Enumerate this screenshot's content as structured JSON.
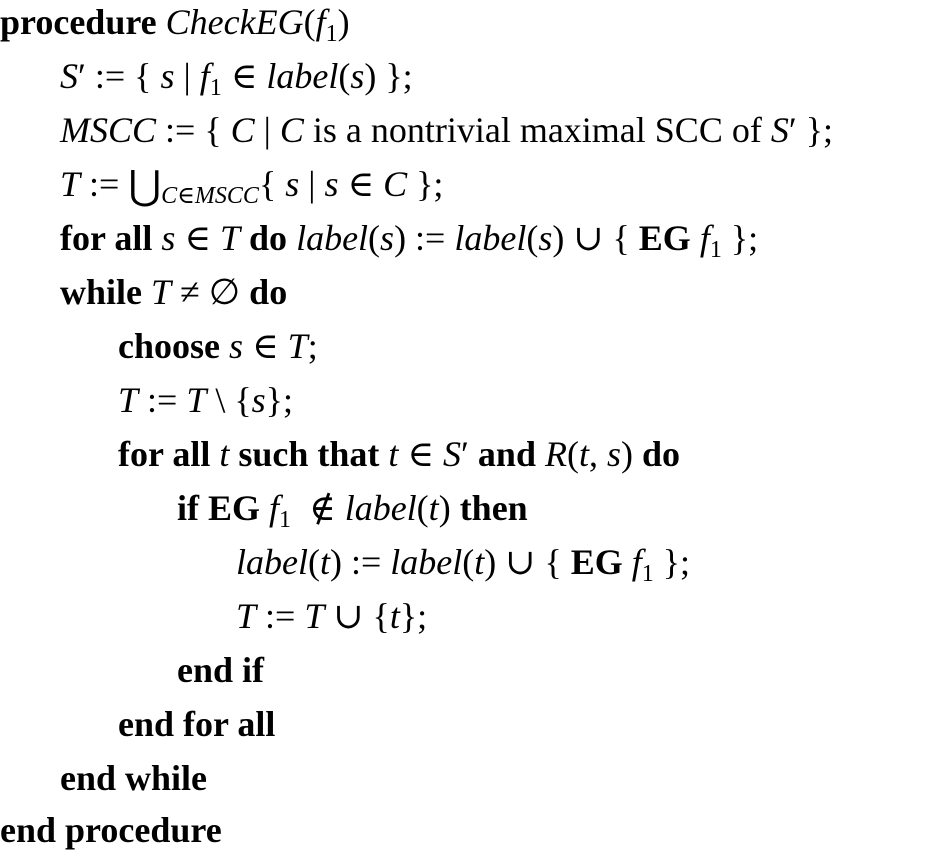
{
  "keywords": {
    "procedure": "procedure",
    "for_all": "for all",
    "do": "do",
    "while": "while",
    "choose": "choose",
    "such_that": "such that",
    "and": "and",
    "if": "if",
    "then": "then",
    "end_if": "end if",
    "end_for_all": "end for all",
    "end_while": "end while",
    "end_procedure": "end procedure",
    "EG": "EG"
  },
  "names": {
    "proc_name": "CheckEG",
    "f": "f",
    "one": "1",
    "S": "S",
    "label": "label",
    "MSCC": "MSCC",
    "T": "T",
    "C": "C",
    "s": "s",
    "t": "t",
    "R": "R",
    "cmscc": "C∈MSCC"
  },
  "text": {
    "nontrivial": " is a nontrivial maximal SCC of "
  }
}
